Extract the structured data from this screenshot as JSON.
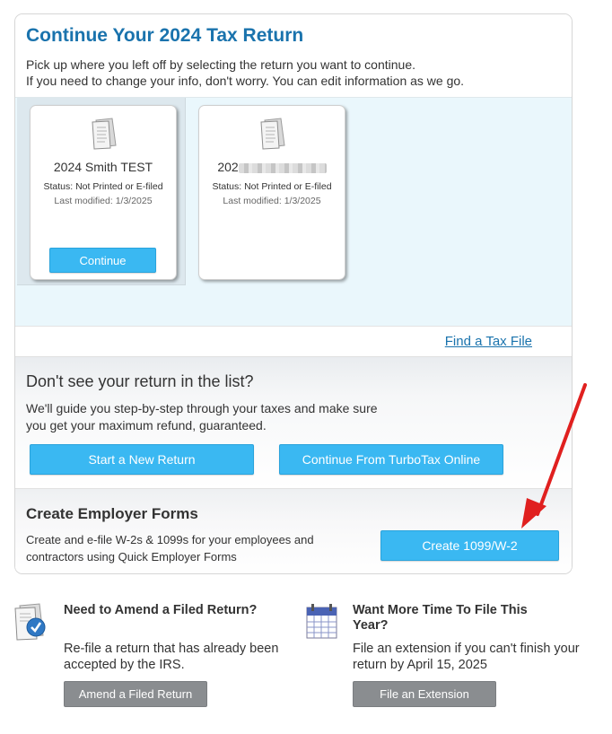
{
  "header": {
    "title": "Continue Your  2024 Tax Return",
    "intro_line1": "Pick up where you left off by selecting the return you want to continue.",
    "intro_line2": "If you need to change your info, don't worry.  You can edit information as we go."
  },
  "files": [
    {
      "name": "2024 Smith TEST",
      "status": "Status: Not Printed or E-filed",
      "modified": "Last modified: 1/3/2025",
      "continue_label": "Continue"
    },
    {
      "name_prefix": "202",
      "status": "Status: Not Printed or E-filed",
      "modified": "Last modified: 1/3/2025"
    }
  ],
  "find_link": "Find a Tax File",
  "dont_see": {
    "title": "Don't see your return in the list?",
    "desc": "We'll guide you step-by-step through your taxes and make sure you get your maximum refund, guaranteed.",
    "start_label": "Start a New Return",
    "tto_label": "Continue From TurboTax Online"
  },
  "employer": {
    "title": "Create Employer Forms",
    "desc": "Create and e-file W-2s & 1099s for your employees and contractors using Quick Employer Forms",
    "button_label": "Create 1099/W-2"
  },
  "amend": {
    "icon": "document-check-icon",
    "title": "Need to Amend a Filed Return?",
    "desc": "Re-file a return that has already been accepted by the IRS.",
    "button_label": "Amend a Filed Return"
  },
  "extension": {
    "icon": "calendar-icon",
    "title": "Want More Time To File This Year?",
    "desc": "File an extension if you can't finish your return by April 15, 2025",
    "button_label": "File an Extension"
  },
  "colors": {
    "title_blue": "#1a73ad",
    "button_blue": "#3ab8f2",
    "button_gray": "#8a8d90",
    "files_bg": "#eaf7fc",
    "arrow_red": "#e0201f"
  }
}
